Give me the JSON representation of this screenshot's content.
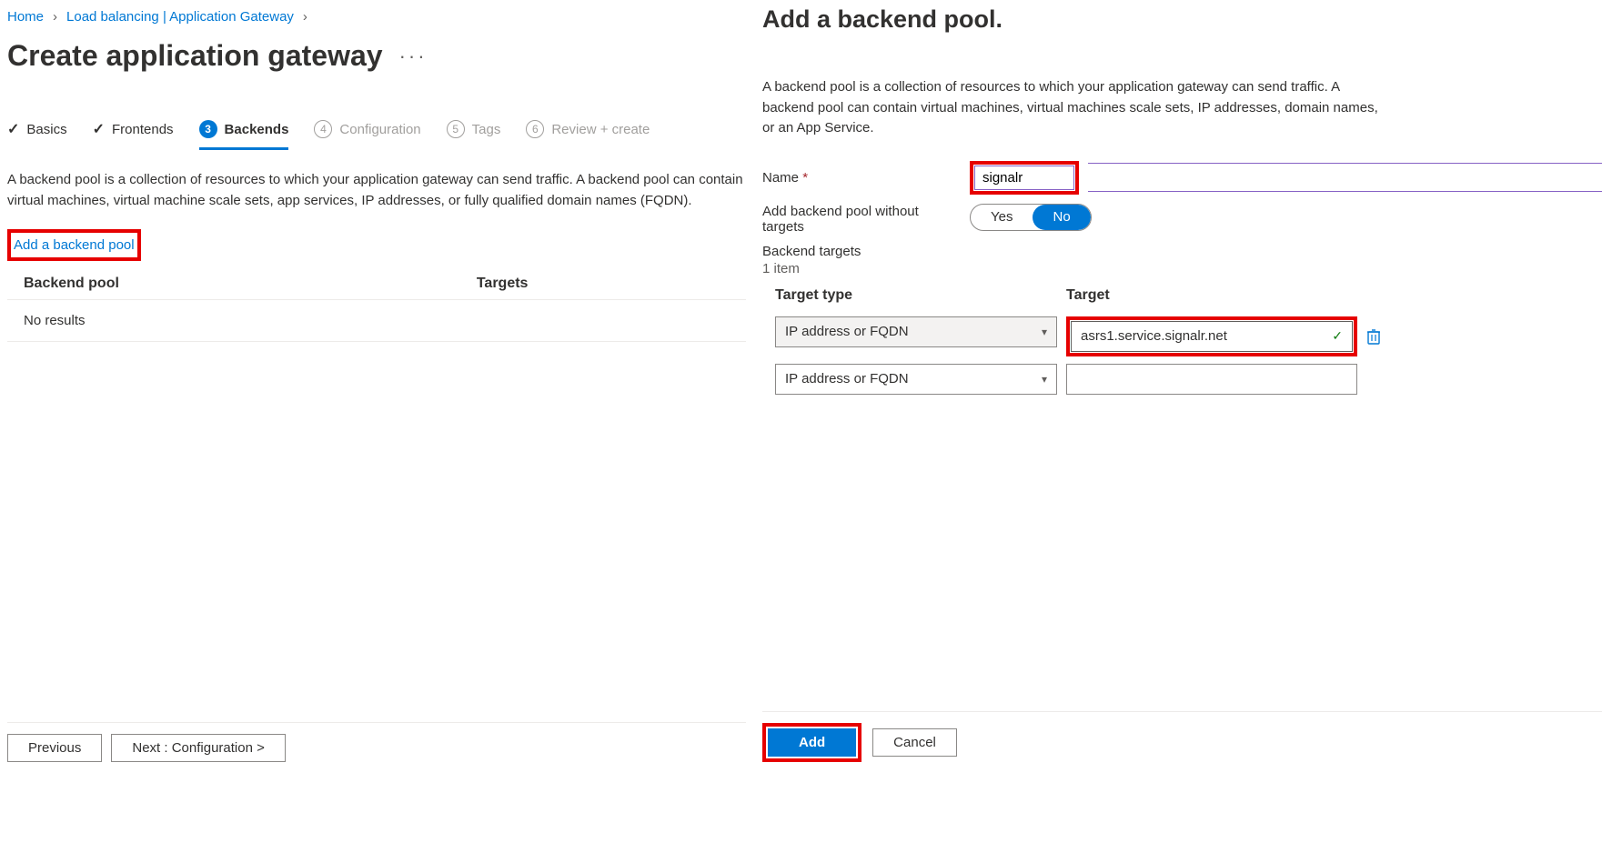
{
  "breadcrumb": {
    "home": "Home",
    "load_balancing": "Load balancing | Application Gateway"
  },
  "page": {
    "title": "Create application gateway"
  },
  "tabs": {
    "basics": "Basics",
    "frontends": "Frontends",
    "backends": "Backends",
    "backends_num": "3",
    "configuration": "Configuration",
    "configuration_num": "4",
    "tags": "Tags",
    "tags_num": "5",
    "review": "Review + create",
    "review_num": "6"
  },
  "intro": "A backend pool is a collection of resources to which your application gateway can send traffic. A backend pool can contain virtual machines, virtual machine scale sets, app services, IP addresses, or fully qualified domain names (FQDN).",
  "add_link": "Add a backend pool",
  "pool_table": {
    "col_pool": "Backend pool",
    "col_targets": "Targets",
    "no_results": "No results"
  },
  "footer": {
    "previous": "Previous",
    "next": "Next : Configuration >"
  },
  "panel": {
    "title": "Add a backend pool.",
    "desc": "A backend pool is a collection of resources to which your application gateway can send traffic. A backend pool can contain virtual machines, virtual machines scale sets, IP addresses, domain names, or an App Service.",
    "name_label": "Name",
    "name_value": "signalr",
    "no_targets_label": "Add backend pool without targets",
    "toggle_yes": "Yes",
    "toggle_no": "No",
    "backend_targets_label": "Backend targets",
    "item_count": "1 item",
    "table": {
      "col_type": "Target type",
      "col_target": "Target",
      "row1_type": "IP address or FQDN",
      "row1_target": "asrs1.service.signalr.net",
      "row2_type": "IP address or FQDN"
    },
    "footer": {
      "add": "Add",
      "cancel": "Cancel"
    }
  }
}
